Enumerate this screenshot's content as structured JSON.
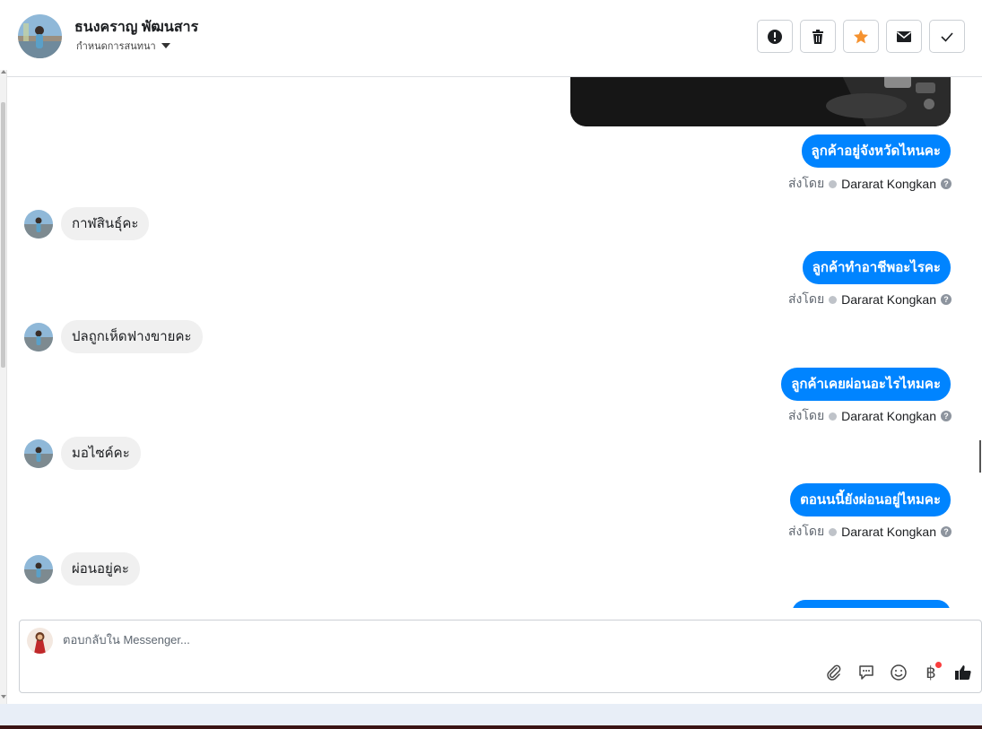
{
  "header": {
    "contact_name": "ธนงคราญ พัฒนสาร",
    "subtitle": "กำหนดการสนทนา",
    "actions": [
      {
        "icon": "spam-icon"
      },
      {
        "icon": "trash-icon"
      },
      {
        "icon": "star-icon",
        "color": "#f5922f"
      },
      {
        "icon": "mail-icon"
      },
      {
        "icon": "check-icon"
      }
    ]
  },
  "thread": {
    "sent_by_label": "ส่งโดย",
    "sender_name": "Dararat Kongkan",
    "help_glyph": "?",
    "messages": [
      {
        "direction": "out",
        "text": "ลูกค้าอยู่จังหวัดไหนคะ"
      },
      {
        "direction": "in",
        "text": "กาฬสินธุ์คะ"
      },
      {
        "direction": "out",
        "text": "ลูกค้าทำอาชีพอะไรคะ"
      },
      {
        "direction": "in",
        "text": "ปลถูกเห็ดฟางขายคะ"
      },
      {
        "direction": "out",
        "text": "ลูกค้าเคยผ่อนอะไรไหมคะ"
      },
      {
        "direction": "in",
        "text": "มอไซค์คะ"
      },
      {
        "direction": "out",
        "text": "ตอนนนี้ยังผ่อนอยู่ไหมคะ"
      },
      {
        "direction": "in",
        "text": "ผ่อนอยู่คะ"
      }
    ]
  },
  "composer": {
    "placeholder": "ตอบกลับใน Messenger...",
    "tools": [
      "attach-icon",
      "saved-reply-icon",
      "emoji-icon",
      "payment-icon",
      "like-icon"
    ],
    "payment_glyph": "฿"
  },
  "colors": {
    "outgoing_bubble": "#0084ff",
    "incoming_bubble": "#f0f0f0",
    "star": "#f5922f"
  }
}
